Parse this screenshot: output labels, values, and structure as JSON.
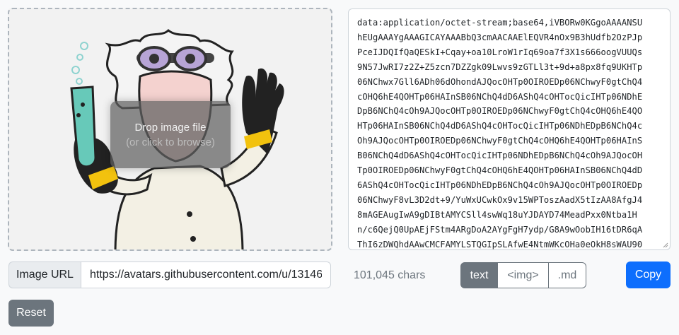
{
  "dropzone": {
    "title": "Drop image file",
    "subtitle": "(or click to browse)"
  },
  "output": {
    "lines": [
      "data:application/octet-stream;base64,iVBORw0KGgoAAAANSU",
      "hEUgAAAYgAAAGICAYAAABbQ3cmAACAAElEQVR4nOx9B3hUdfb2OzPJp",
      "PceIJDQIfQaQESkI+Cqay+oa10LroW1rIq69oa7f3X1s666oogVUUQs",
      "9N57JwRI7z2Z+Z5zcn7DZZgk09Lwvs9zGTLl3t+9d+a8px8fq9UKHTp",
      "06NChwx7Gll6ADh06dOhondAJQocOHTp0OIROEDp06NChwyF0gtChQ4",
      "cOHQ6hE4QOHTp06HAInSB06NChQ4dD6AShQ4cOHTocQicIHTp06NDhE",
      "DpB6NChQ4cOh9AJQocOHTp0OIROEDp06NChwyF0gtChQ4cOHQ6hE4QO",
      "HTp06HAInSB06NChQ4dD6AShQ4cOHTocQicIHTp06NDhEDpB6NChQ4c",
      "Oh9AJQocOHTp0OIROEDp06NChwyF0gtChQ4cOHQ6hE4QOHTp06HAInS",
      "B06NChQ4dD6AShQ4cOHTocQicIHTp06NDhEDpB6NChQ4cOh9AJQocOH",
      "Tp0OIROEDp06NChwyF0gtChQ4cOHQ6hE4QOHTp06HAInSB06NChQ4dD",
      "6AShQ4cOHTocQicIHTp06NDhEDpB6NChQ4cOh9AJQocOHTp0OIROEDp",
      "06NChwyF8vL3D2dt+9/YuWxUCwkOx9v15WPToszAadX5tIzAA8AfgJ4",
      "8mAGEAugIwA9gDIBtAMYCSll4swWq18uYJDAYD74MeadPxx0Ntba1H",
      "n/c6QejQ0UpAEjFStm4ARgDoA2AYgFgH7ydp/G8A9wOobIH16tDR6qA",
      "ThI6zDWQhdAAwCMCFAMYLSTQGIpSLAfwE4NtmWKcOHa0eOkH8sWAU90"
    ]
  },
  "url": {
    "label": "Image URL",
    "value": "https://avatars.githubusercontent.com/u/13146"
  },
  "char_count": "101,045 chars",
  "formats": {
    "text": "text",
    "img": "<img>",
    "md": ".md"
  },
  "buttons": {
    "copy": "Copy",
    "reset": "Reset"
  }
}
